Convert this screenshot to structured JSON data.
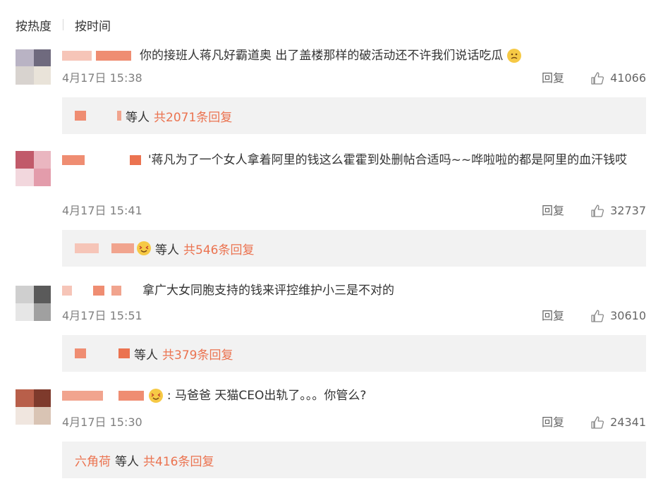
{
  "sort_bar": {
    "active": "按热度",
    "inactive": "按时间"
  },
  "comments": [
    {
      "text": "你的接班人蒋凡好霸道奥 出了盖楼那样的破活动还不许我们说话吃瓜",
      "time": "4月17日 15:38",
      "reply": "回复",
      "likes": "41066",
      "sub": {
        "etc": "等人",
        "count": "共2071条回复"
      }
    },
    {
      "text": "'蒋凡为了一个女人拿着阿里的钱这么霍霍到处删帖合适吗~~哗啦啦的都是阿里的血汗钱哎",
      "time": "4月17日 15:41",
      "reply": "回复",
      "likes": "32737",
      "sub": {
        "etc": "等人",
        "count": "共546条回复"
      }
    },
    {
      "text": "拿广大女同胞支持的钱来评控维护小三是不对的",
      "time": "4月17日 15:51",
      "reply": "回复",
      "likes": "30610",
      "sub": {
        "etc": "等人",
        "count": "共379条回复"
      }
    },
    {
      "text": ": 马爸爸  天猫CEO出轨了。。。你管么?",
      "time": "4月17日 15:30",
      "reply": "回复",
      "likes": "24341",
      "sub": {
        "name": "六角荷",
        "etc": "等人",
        "count": "共416条回复"
      }
    }
  ],
  "colors": {
    "accent": "#eb7350",
    "meta": "#808080",
    "sub_bg": "#f2f2f2"
  },
  "icons": {
    "like": "thumbs-up-icon",
    "emoji": "emoji-icon"
  }
}
